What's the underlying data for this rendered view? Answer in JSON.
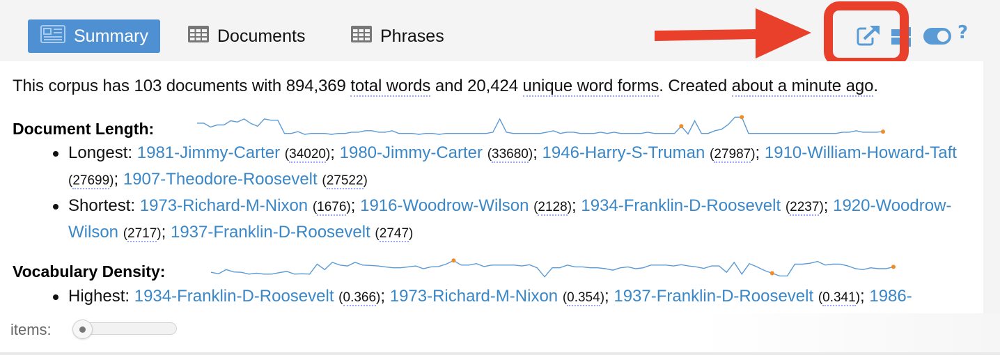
{
  "tabs": [
    {
      "label": "Summary",
      "icon": "newspaper-icon",
      "active": true
    },
    {
      "label": "Documents",
      "icon": "table-icon",
      "active": false
    },
    {
      "label": "Phrases",
      "icon": "table-icon",
      "active": false
    }
  ],
  "toolbar": {
    "export_icon": "export-icon",
    "layout_icon": "window-layout-icon",
    "toggle_icon": "toggle-on-icon",
    "help_label": "?"
  },
  "annotation": {
    "arrow_color": "#e8402a",
    "box_color": "#e8402a"
  },
  "colors": {
    "accent": "#4f90d2",
    "link": "#3a87c8",
    "sparkline": "#5b9bd5",
    "sparkline_marker": "#f08c2a"
  },
  "summary": {
    "p1": "This corpus has 103 documents with 894,369 ",
    "total_words_label": "total words",
    "p2": " and 20,424 ",
    "unique_forms_label": "unique word forms",
    "p3": ". Created ",
    "created_label": "about a minute ago",
    "p4": "."
  },
  "document_length": {
    "title": "Document Length:",
    "longest_label": "Longest:",
    "longest": [
      {
        "name": "1981-Jimmy-Carter",
        "value": "34020"
      },
      {
        "name": "1980-Jimmy-Carter",
        "value": "33680"
      },
      {
        "name": "1946-Harry-S-Truman",
        "value": "27987"
      },
      {
        "name": "1910-William-Howard-Taft",
        "value": "27699"
      },
      {
        "name": "1907-Theodore-Roosevelt",
        "value": "27522"
      }
    ],
    "shortest_label": "Shortest:",
    "shortest": [
      {
        "name": "1973-Richard-M-Nixon",
        "value": "1676"
      },
      {
        "name": "1916-Woodrow-Wilson",
        "value": "2128"
      },
      {
        "name": "1934-Franklin-D-Roosevelt",
        "value": "2237"
      },
      {
        "name": "1920-Woodrow-Wilson",
        "value": "2717"
      },
      {
        "name": "1937-Franklin-D-Roosevelt",
        "value": "2747"
      }
    ]
  },
  "vocabulary_density": {
    "title": "Vocabulary Density:",
    "highest_label": "Highest:",
    "highest": [
      {
        "name": "1934-Franklin-D-Roosevelt",
        "value": "0.366"
      },
      {
        "name": "1973-Richard-M-Nixon",
        "value": "0.354"
      },
      {
        "name": "1937-Franklin-D-Roosevelt",
        "value": "0.341"
      },
      {
        "name": "1986-",
        "value": ""
      }
    ]
  },
  "footer": {
    "items_label": "items:",
    "slider_value": 0
  },
  "chart_data": [
    {
      "type": "line",
      "title": "Document Length sparkline",
      "values": [
        0.62,
        0.62,
        0.4,
        0.52,
        0.52,
        0.75,
        0.68,
        0.85,
        0.6,
        0.45,
        0.85,
        0.78,
        0.78,
        0.05,
        0.05,
        0.15,
        0.0,
        0.05,
        0.05,
        0.05,
        0.0,
        0.05,
        0.05,
        0.12,
        0.12,
        0.2,
        0.2,
        0.12,
        0.12,
        0.2,
        0.05,
        0.05,
        0.05,
        0.0,
        0.05,
        0.05,
        0.0,
        0.05,
        0.05,
        0.05,
        0.05,
        0.05,
        0.05,
        0.05,
        0.12,
        0.85,
        0.12,
        0.05,
        0.05,
        0.05,
        0.05,
        0.05,
        0.12,
        0.2,
        0.05,
        0.12,
        0.12,
        0.05,
        0.05,
        0.05,
        0.12,
        0.05,
        0.12,
        0.05,
        0.05,
        0.05,
        0.05,
        0.12,
        0.05,
        0.05,
        0.05,
        0.05,
        0.45,
        0.02,
        0.75,
        0.05,
        0.05,
        0.2,
        0.28,
        0.55,
        0.95,
        0.95,
        0.05,
        0.05,
        0.05,
        0.05,
        0.05,
        0.05,
        0.05,
        0.05,
        0.05,
        0.05,
        0.05,
        0.05,
        0.05,
        0.05,
        0.12,
        0.12,
        0.2,
        0.12,
        0.12,
        0.12,
        0.15
      ],
      "markers": [
        {
          "index": 72,
          "kind": "min"
        },
        {
          "index": 81,
          "kind": "max"
        },
        {
          "index": 102,
          "kind": "last"
        }
      ]
    },
    {
      "type": "line",
      "title": "Vocabulary Density sparkline",
      "values": [
        0.3,
        0.22,
        0.45,
        0.32,
        0.3,
        0.2,
        0.25,
        0.2,
        0.2,
        0.28,
        0.35,
        0.2,
        0.22,
        0.2,
        0.75,
        0.45,
        0.85,
        0.7,
        0.65,
        0.85,
        0.7,
        0.68,
        0.65,
        0.6,
        0.55,
        0.55,
        0.6,
        0.65,
        0.5,
        0.6,
        0.62,
        0.75,
        0.95,
        0.7,
        0.7,
        0.78,
        0.62,
        0.7,
        0.7,
        0.7,
        0.7,
        0.65,
        0.72,
        0.55,
        0.05,
        0.55,
        0.55,
        0.7,
        0.6,
        0.6,
        0.55,
        0.55,
        0.5,
        0.42,
        0.55,
        0.6,
        0.5,
        0.55,
        0.7,
        0.7,
        0.7,
        0.65,
        0.72,
        0.65,
        0.6,
        0.52,
        0.65,
        0.65,
        0.3,
        0.85,
        0.2,
        0.78,
        0.6,
        0.4,
        0.25,
        0.1,
        0.1,
        0.75,
        0.75,
        0.8,
        0.9,
        0.7,
        0.75,
        0.75,
        0.65,
        0.5,
        0.45,
        0.55,
        0.5,
        0.5,
        0.6
      ],
      "markers": [
        {
          "index": 32,
          "kind": "max"
        },
        {
          "index": 74,
          "kind": "min"
        },
        {
          "index": 90,
          "kind": "last"
        }
      ]
    }
  ]
}
